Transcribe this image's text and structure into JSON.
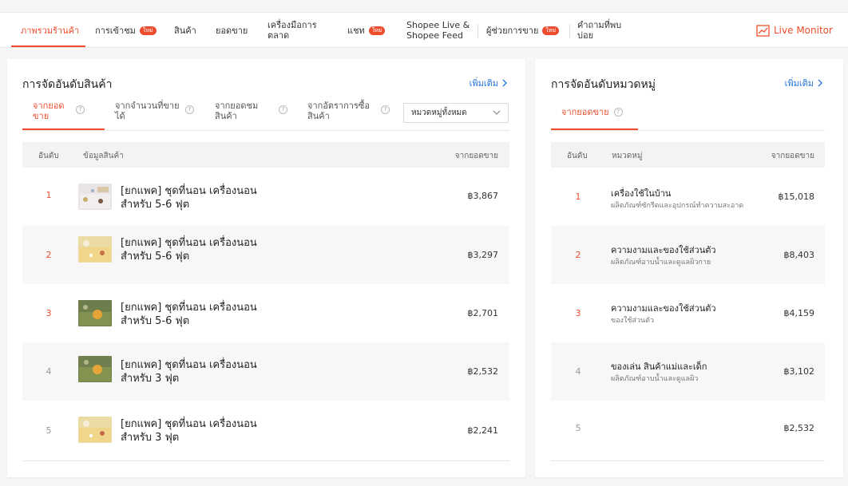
{
  "nav": {
    "items": [
      {
        "label": "ภาพรวมร้านค้า"
      },
      {
        "label": "การเข้าชม",
        "badge": "ใหม่"
      },
      {
        "label": "สินค้า"
      },
      {
        "label": "ยอดขาย"
      },
      {
        "label": "เครื่องมือการตลาด"
      },
      {
        "label": "แชท",
        "badge": "ใหม่"
      },
      {
        "label": "Shopee Live & Shopee Feed"
      },
      {
        "label": "ผู้ช่วยการขาย",
        "badge": "ใหม่"
      },
      {
        "label": "คำถามที่พบบ่อย"
      }
    ],
    "live_monitor": "Live Monitor",
    "accent_color": "#ee4d2d"
  },
  "product_ranking": {
    "title": "การจัดอันดับสินค้า",
    "more": "เพิ่มเติม",
    "tabs": [
      {
        "label": "จากยอดขาย"
      },
      {
        "label": "จากจำนวนที่ขายได้"
      },
      {
        "label": "จากยอดชมสินค้า"
      },
      {
        "label": "จากอัตราการซื้อสินค้า"
      }
    ],
    "category_select": "หมวดหมู่ทั้งหมด",
    "columns": {
      "rank": "อันดับ",
      "info": "ข้อมูลสินค้า",
      "value": "จากยอดขาย"
    },
    "rows": [
      {
        "rank": "1",
        "name": "[ยกแพค] ชุดที่นอน เครื่องนอนสำหรับ 5-6 ฟุต",
        "amount": "฿3,867"
      },
      {
        "rank": "2",
        "name": "[ยกแพค] ชุดที่นอน เครื่องนอนสำหรับ 5-6 ฟุต",
        "amount": "฿3,297"
      },
      {
        "rank": "3",
        "name": "[ยกแพค] ชุดที่นอน เครื่องนอนสำหรับ 5-6 ฟุต",
        "amount": "฿2,701"
      },
      {
        "rank": "4",
        "name": "[ยกแพค] ชุดที่นอน เครื่องนอนสำหรับ 3 ฟุต",
        "amount": "฿2,532"
      },
      {
        "rank": "5",
        "name": "[ยกแพค] ชุดที่นอน เครื่องนอนสำหรับ 3 ฟุต",
        "amount": "฿2,241"
      }
    ]
  },
  "category_ranking": {
    "title": "การจัดอันดับหมวดหมู่",
    "more": "เพิ่มเติม",
    "tab": "จากยอดขาย",
    "columns": {
      "rank": "อันดับ",
      "category": "หมวดหมู่",
      "value": "จากยอดขาย"
    },
    "rows": [
      {
        "rank": "1",
        "name": "เครื่องใช้ในบ้าน",
        "sub": "ผลิตภัณฑ์ซักรีดและอุปกรณ์ทำความสะอาด",
        "amount": "฿15,018"
      },
      {
        "rank": "2",
        "name": "ความงามและของใช้ส่วนตัว",
        "sub": "ผลิตภัณฑ์อาบน้ำและดูแลผิวกาย",
        "amount": "฿8,403"
      },
      {
        "rank": "3",
        "name": "ความงามและของใช้ส่วนตัว",
        "sub": "ของใช้ส่วนตัว",
        "amount": "฿4,159"
      },
      {
        "rank": "4",
        "name": "ของเล่น สินค้าแม่และเด็ก",
        "sub": "ผลิตภัณฑ์อาบน้ำและดูแลผิว",
        "amount": "฿3,102"
      },
      {
        "rank": "5",
        "name": "",
        "sub": "",
        "amount": "฿2,532"
      }
    ]
  }
}
